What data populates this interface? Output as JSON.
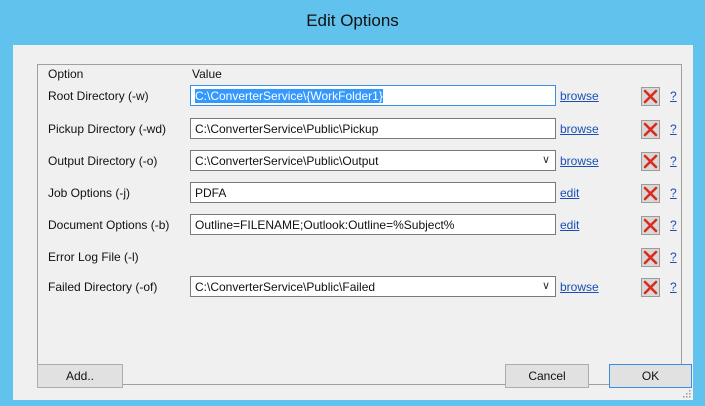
{
  "window": {
    "title": "Edit Options"
  },
  "columns": {
    "option": "Option",
    "value": "Value"
  },
  "rows": [
    {
      "label": "Root Directory (-w)",
      "value_selected": "C:\\ConverterService\\{WorkFolder1}",
      "value": "",
      "link": "browse"
    },
    {
      "label": "Pickup Directory (-wd)",
      "value": "C:\\ConverterService\\Public\\Pickup",
      "link": "browse"
    },
    {
      "label": "Output Directory (-o)",
      "value": "C:\\ConverterService\\Public\\Output",
      "link": "browse"
    },
    {
      "label": "Job Options (-j)",
      "value": "PDFA",
      "link": "edit"
    },
    {
      "label": "Document Options (-b)",
      "value": "Outline=FILENAME;Outlook:Outline=%Subject%",
      "link": "edit"
    },
    {
      "label": "Error Log File (-l)"
    },
    {
      "label": "Failed Directory (-of)",
      "value": "C:\\ConverterService\\Public\\Failed",
      "link": "browse"
    }
  ],
  "help_label": "?",
  "icons": {
    "delete": "red-x-icon",
    "dropdown": "chevron-down-icon",
    "resize": "resize-grip-icon"
  },
  "colors": {
    "titlebar": "#62c2ee",
    "delete_x": "#d92b1e",
    "link": "#1a4fb5",
    "selection": "#3399ff"
  },
  "buttons": {
    "add": "Add..",
    "cancel": "Cancel",
    "ok": "OK"
  }
}
